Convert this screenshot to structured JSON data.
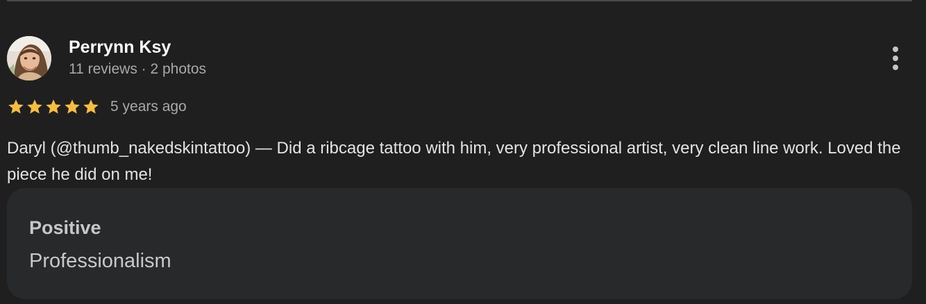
{
  "review": {
    "author_name": "Perrynn Ksy",
    "author_meta": "11 reviews · 2 photos",
    "rating": 5,
    "rating_max": 5,
    "date": "5 years ago",
    "text": "Daryl (@thumb_nakedskintattoo) — Did a ribcage tattoo with him, very professional artist, very clean line work. Loved the piece he did on me!"
  },
  "summary": {
    "label": "Positive",
    "value": "Professionalism"
  },
  "icons": {
    "more": "more-vert-icon",
    "star": "star-icon",
    "avatar": "avatar-photo"
  },
  "colors": {
    "background": "#1f1f1f",
    "star": "#f6bd41",
    "card": "#28292b"
  }
}
